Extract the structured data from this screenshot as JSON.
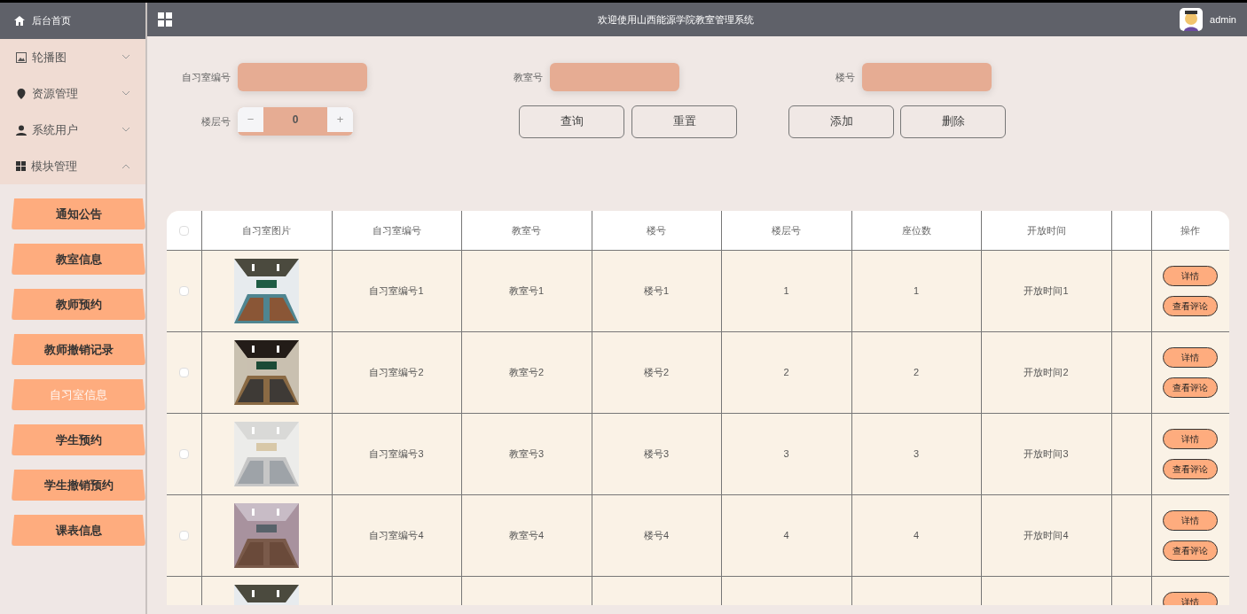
{
  "header": {
    "home": "后台首页",
    "title": "欢迎使用山西能源学院教室管理系统",
    "user": "admin"
  },
  "sidebar": {
    "menus": [
      {
        "label": "轮播图",
        "expanded": false
      },
      {
        "label": "资源管理",
        "expanded": false
      },
      {
        "label": "系统用户",
        "expanded": false
      },
      {
        "label": "模块管理",
        "expanded": true
      }
    ],
    "items": [
      {
        "label": "通知公告",
        "selected": false
      },
      {
        "label": "教室信息",
        "selected": false
      },
      {
        "label": "教师预约",
        "selected": false
      },
      {
        "label": "教师撤销记录",
        "selected": false
      },
      {
        "label": "自习室信息",
        "selected": true
      },
      {
        "label": "学生预约",
        "selected": false
      },
      {
        "label": "学生撤销预约",
        "selected": false
      },
      {
        "label": "课表信息",
        "selected": false
      }
    ]
  },
  "search": {
    "fields": [
      {
        "label": "自习室编号"
      },
      {
        "label": "教室号"
      },
      {
        "label": "楼号"
      }
    ],
    "floor": {
      "label": "楼层号",
      "value": "0",
      "minus": "−",
      "plus": "+"
    },
    "buttons": [
      "查询",
      "重置",
      "添加",
      "删除"
    ]
  },
  "table": {
    "header_checked": false,
    "columns": [
      "自习室图片",
      "自习室编号",
      "教室号",
      "楼号",
      "楼层号",
      "座位数",
      "开放时间",
      "",
      "操作"
    ],
    "rows": [
      {
        "checked": false,
        "cells": [
          "",
          "自习室编号1",
          "教室号1",
          "楼号1",
          "1",
          "1",
          "开放时间1"
        ],
        "actions": [
          "详情",
          "查看评论"
        ]
      },
      {
        "checked": false,
        "cells": [
          "",
          "自习室编号2",
          "教室号2",
          "楼号2",
          "2",
          "2",
          "开放时间2"
        ],
        "actions": [
          "详情",
          "查看评论"
        ]
      },
      {
        "checked": false,
        "cells": [
          "",
          "自习室编号3",
          "教室号3",
          "楼号3",
          "3",
          "3",
          "开放时间3"
        ],
        "actions": [
          "详情",
          "查看评论"
        ]
      },
      {
        "checked": false,
        "cells": [
          "",
          "自习室编号4",
          "教室号4",
          "楼号4",
          "4",
          "4",
          "开放时间4"
        ],
        "actions": [
          "详情",
          "查看评论"
        ]
      }
    ],
    "partial_row": {
      "actions": [
        "详情"
      ]
    }
  }
}
